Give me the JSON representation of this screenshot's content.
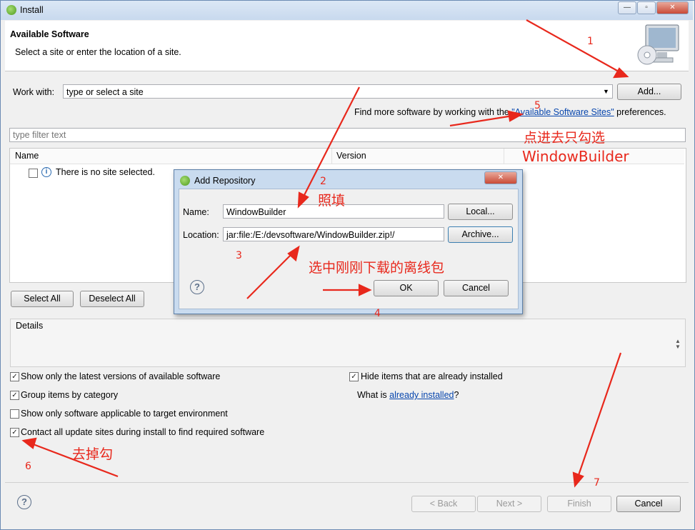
{
  "window": {
    "title": "Install"
  },
  "header": {
    "title": "Available Software",
    "subtitle": "Select a site or enter the location of a site."
  },
  "work_with": {
    "label": "Work with:",
    "value": "type or select a site",
    "add_label": "Add..."
  },
  "find_more": {
    "prefix": "Find more software by working with the ",
    "link": "\"Available Software Sites\"",
    "suffix": " preferences."
  },
  "filter": {
    "placeholder": "type filter text"
  },
  "table": {
    "columns": [
      "Name",
      "Version"
    ],
    "empty_message": "There is no site selected."
  },
  "buttons": {
    "select_all": "Select All",
    "deselect_all": "Deselect All"
  },
  "details": {
    "label": "Details"
  },
  "options": {
    "show_latest": "Show only the latest versions of available software",
    "group_by_category": "Group items by category",
    "show_applicable": "Show only software applicable to target environment",
    "contact_sites": "Contact all update sites during install to find required software",
    "hide_installed": "Hide items that are already installed",
    "what_is_prefix": "What is ",
    "already_installed_link": "already installed",
    "what_is_suffix": "?"
  },
  "footer": {
    "back": "< Back",
    "next": "Next >",
    "finish": "Finish",
    "cancel": "Cancel"
  },
  "dialog": {
    "title": "Add Repository",
    "name_label": "Name:",
    "name_value": "WindowBuilder",
    "local_button": "Local...",
    "location_label": "Location:",
    "location_value": "jar:file:/E:/devsoftware/WindowBuilder.zip!/",
    "archive_button": "Archive...",
    "ok": "OK",
    "cancel": "Cancel"
  },
  "annotations": {
    "n1": "1",
    "n2": "2",
    "n3": "3",
    "n4": "4",
    "n5": "5",
    "n6": "6",
    "n7": "7",
    "fill_in": "照填",
    "click_in_line1": "点进去只勾选",
    "click_in_line2": "WindowBuilder",
    "select_offline": "选中刚刚下载的离线包",
    "uncheck": "去掉勾"
  },
  "colors": {
    "annotation": "#e8281c",
    "link": "#0645ad"
  }
}
